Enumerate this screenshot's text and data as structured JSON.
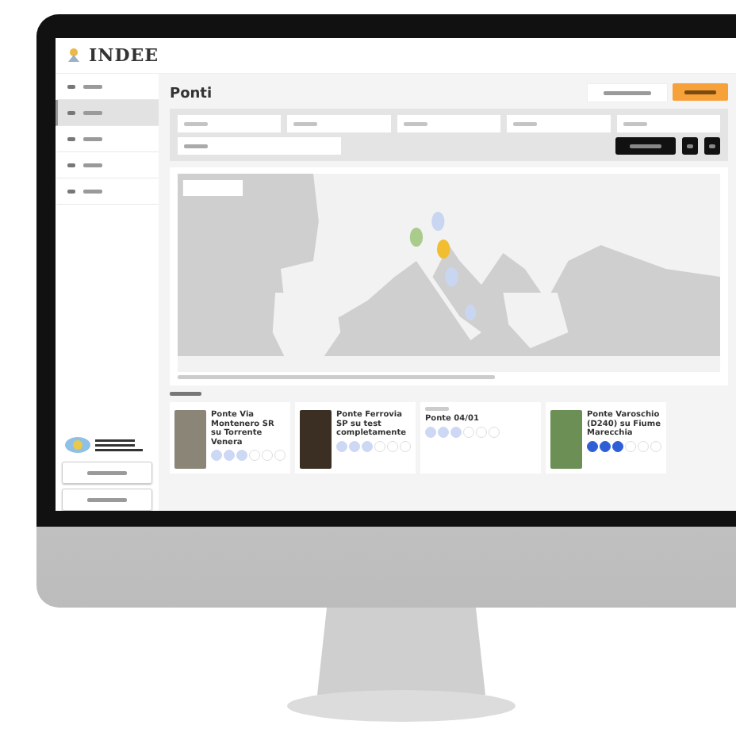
{
  "app": {
    "logo": "INDEE",
    "sidebar_items": [
      {
        "selected": false
      },
      {
        "selected": true
      },
      {
        "selected": false
      },
      {
        "selected": false
      },
      {
        "selected": false
      }
    ],
    "page_title": "Ponti",
    "cards": [
      {
        "title": "Ponte Via Montenero SR su Torrente Venera",
        "has_photo": true,
        "stars": 3,
        "emphasized": false
      },
      {
        "title": "Ponte Ferrovia SP su test completamente",
        "has_photo": true,
        "stars": 3,
        "emphasized": false
      },
      {
        "title": "Ponte 04/01",
        "has_photo": false,
        "stars": 3,
        "emphasized": false
      },
      {
        "title": "Ponte Varoschio (D240) su Fiume Marecchia",
        "has_photo": true,
        "stars": 3,
        "emphasized": true
      }
    ]
  }
}
